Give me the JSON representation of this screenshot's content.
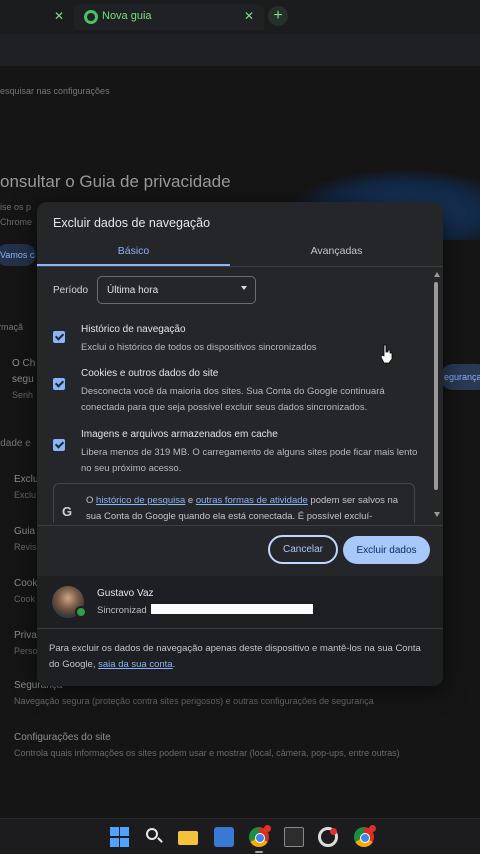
{
  "browser": {
    "active_tab_title": "Nova guia",
    "new_tab_label": "+",
    "tab_close_label": "✕"
  },
  "settings_background": {
    "search_placeholder": "esquisar nas configurações",
    "privacy_guide_title": "onsultar o Guia de privacidade",
    "privacy_guide_sub1": "ise os p",
    "privacy_guide_sub2": "Chrome",
    "privacy_guide_button": "Vamos c",
    "section_label_1": "rmaçã",
    "item_1_title": "O Ch",
    "item_1_sub": "segu",
    "item_1_desc": "Senh",
    "right_button": "egurança",
    "section_label_2": "idade e",
    "rows": [
      {
        "title": "Exclu",
        "desc": "Exclu"
      },
      {
        "title": "Guia",
        "desc": "Revis"
      },
      {
        "title": "Cook",
        "desc": "Cook"
      },
      {
        "title": "Priva",
        "desc": "Perso"
      }
    ],
    "security_title": "Segurança",
    "security_desc": "Navegação segura (proteção contra sites perigosos) e outras configurações de segurança",
    "site_settings_title": "Configurações do site",
    "site_settings_desc": "Controla quais informações os sites podem usar e mostrar (local, câmera, pop-ups, entre outras)"
  },
  "dialog": {
    "title": "Excluir dados de navegação",
    "tabs": [
      {
        "label": "Básico",
        "selected": true
      },
      {
        "label": "Avançadas",
        "selected": false
      }
    ],
    "period_label": "Período",
    "period_value": "Última hora",
    "options": [
      {
        "title": "Histórico de navegação",
        "desc": "Exclui o histórico de todos os dispositivos sincronizados",
        "checked": true
      },
      {
        "title": "Cookies e outros dados do site",
        "desc": "Desconecta você da maioria dos sites. Sua Conta do Google continuará conectada para que seja possível excluir seus dados sincronizados.",
        "checked": true
      },
      {
        "title": "Imagens e arquivos armazenados em cache",
        "desc": "Libera menos de 319 MB. O carregamento de alguns sites pode ficar mais lento no seu próximo acesso.",
        "checked": true
      }
    ],
    "info": {
      "icon_letter": "G",
      "prefix": "O ",
      "link1": "histórico de pesquisa",
      "middle": " e ",
      "link2": "outras formas de atividade",
      "suffix": " podem ser salvos na sua Conta do Google quando ela está conectada. É possível excluí-"
    },
    "cancel_label": "Cancelar",
    "confirm_label": "Excluir dados",
    "account": {
      "name": "Gustavo Vaz",
      "status": "Sincronizad"
    },
    "note_prefix": "Para excluir os dados de navegação apenas deste dispositivo e mantê-los na sua Conta do Google, ",
    "note_link": "saia da sua conta",
    "note_suffix": "."
  },
  "colors": {
    "accent": "#8ab4f8",
    "dialog_bg": "#25262a",
    "primary_button": "#a8c7fa"
  },
  "taskbar": {
    "icons": [
      "windows-start-icon",
      "search-icon",
      "file-explorer-icon",
      "store-icon",
      "chrome-icon",
      "terminal-icon",
      "obs-icon",
      "chrome-icon"
    ]
  }
}
